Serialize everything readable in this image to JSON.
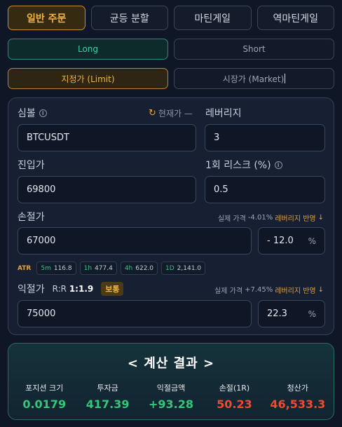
{
  "tabs": [
    "일반 주문",
    "균등 분할",
    "마틴게일",
    "역마틴게일"
  ],
  "side": {
    "long": "Long",
    "short": "Short"
  },
  "order_type": {
    "limit": "지정가 (Limit)",
    "market": "시장가 (Market)"
  },
  "symbol": {
    "label": "심볼",
    "current_price_label": "현재가 —",
    "value": "BTCUSDT"
  },
  "leverage": {
    "label": "레버리지",
    "value": "3"
  },
  "entry": {
    "label": "진입가",
    "value": "69800"
  },
  "risk": {
    "label": "1회 리스크 (%)",
    "value": "0.5"
  },
  "stop": {
    "label": "손절가",
    "real_price_label": "실제 가격",
    "real_price_pct": "-4.01%",
    "leverage_note": "레버리지 반영",
    "value": "67000",
    "pct": "- 12.0",
    "unit": "%"
  },
  "atr": {
    "label": "ATR",
    "chips": [
      {
        "tf": "5m",
        "value": "116.8"
      },
      {
        "tf": "1h",
        "value": "477.4"
      },
      {
        "tf": "4h",
        "value": "622.0"
      },
      {
        "tf": "1D",
        "value": "2,141.0"
      }
    ]
  },
  "take_profit": {
    "label": "익절가",
    "rr_label": "R:R",
    "rr_value": "1:1.9",
    "badge": "보통",
    "real_price_label": "실제 가격",
    "real_price_pct": "+7.45%",
    "leverage_note": "레버리지 반영",
    "value": "75000",
    "pct": "22.3",
    "unit": "%"
  },
  "result": {
    "title": "< 계산 결과 >",
    "stats": [
      {
        "label": "포지션 크기",
        "value": "0.0179",
        "color": "#34c77b"
      },
      {
        "label": "투자금",
        "value": "417.39",
        "color": "#34c77b"
      },
      {
        "label": "익절금액",
        "value": "+93.28",
        "color": "#34c77b"
      },
      {
        "label": "손절(1R)",
        "value": "50.23",
        "color": "#ef4b2c"
      },
      {
        "label": "청산가",
        "value": "46,533.3",
        "color": "#ef4b2c"
      }
    ]
  }
}
